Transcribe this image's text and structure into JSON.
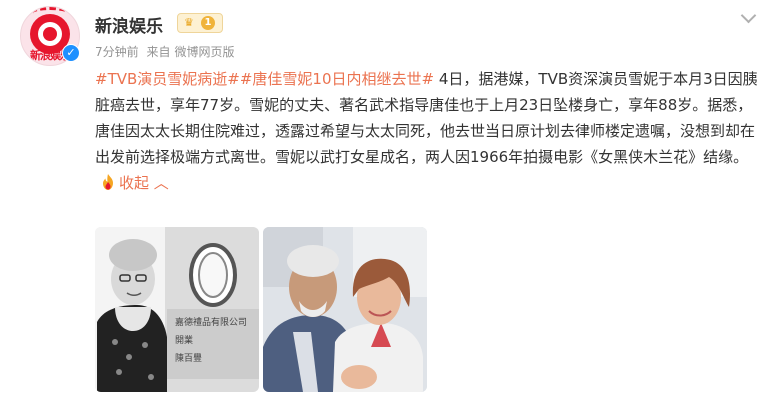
{
  "header": {
    "avatar_label": "新浪娱乐",
    "username": "新浪娱乐",
    "level": "1",
    "time": "7分钟前",
    "source_prefix": "来自",
    "source": "微博网页版"
  },
  "post": {
    "hashtag1": "#TVB演员雪妮病逝#",
    "hashtag2": "#唐佳雪妮10日内相继去世#",
    "body": " 4日，据港媒，TVB资深演员雪妮于本月3日因胰脏癌去世，享年77岁。雪妮的丈夫、著名武术指导唐佳也于上月23日坠楼身亡，享年88岁。据悉，唐佳因太太长期住院难过，透露过希望与太太同死，他去世当日原计划去律师楼定遗嘱，没想到却在出发前选择极端方式离世。雪妮以武打女星成名，两人因1966年拍摄电影《女黑侠木兰花》结缘。",
    "collapse_label": "收起",
    "collapse_icon": "chevron-up-icon"
  },
  "images": [
    {
      "name": "photo-xueni-portrait"
    },
    {
      "name": "photo-couple"
    }
  ],
  "photo1_sign": [
    "嘉德禮品有限公司",
    "開業",
    "陳百豐"
  ],
  "colors": {
    "link": "#eb7350",
    "text": "#333333",
    "meta": "#939393",
    "brand": "#e6162d"
  }
}
